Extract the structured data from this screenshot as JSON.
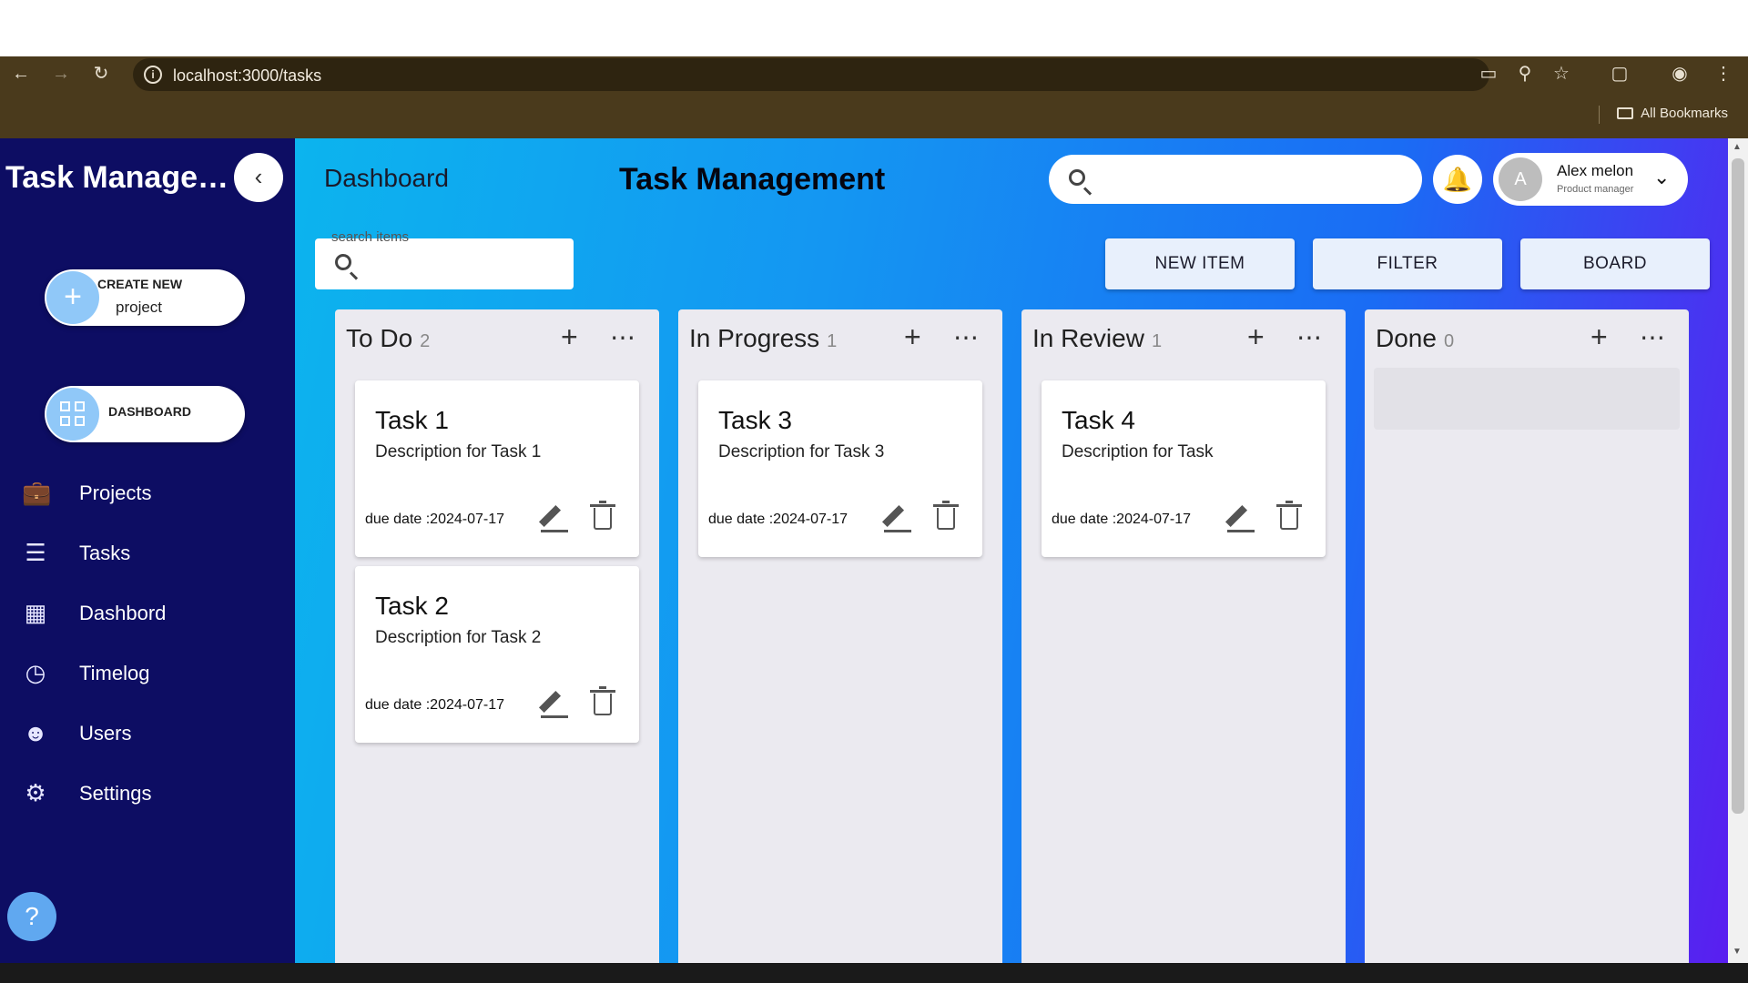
{
  "browser": {
    "url": "localhost:3000/tasks",
    "bookmarks_label": "All Bookmarks"
  },
  "sidebar": {
    "brand": "Task Manage…",
    "create": {
      "label": "CREATE NEW",
      "sub": "project"
    },
    "dashboard_pill": "DASHBOARD",
    "items": [
      {
        "label": "Projects",
        "icon": "briefcase-icon"
      },
      {
        "label": "Tasks",
        "icon": "list-icon"
      },
      {
        "label": "Dashbord",
        "icon": "grid-icon"
      },
      {
        "label": "Timelog",
        "icon": "timer-icon"
      },
      {
        "label": "Users",
        "icon": "users-icon"
      },
      {
        "label": "Settings",
        "icon": "gear-icon"
      }
    ]
  },
  "header": {
    "breadcrumb": "Dashboard",
    "title": "Task Management",
    "user": {
      "avatar_initial": "A",
      "name": "Alex melon",
      "role": "Product manager"
    }
  },
  "toolbar": {
    "search_label": "search items",
    "buttons": [
      "NEW ITEM",
      "FILTER",
      "BOARD"
    ]
  },
  "columns": [
    {
      "name": "To Do",
      "count": "2",
      "cards": [
        {
          "title": "Task 1",
          "description": "Description for Task 1",
          "due": "due date :2024-07-17"
        },
        {
          "title": "Task 2",
          "description": "Description for Task 2",
          "due": "due date :2024-07-17"
        }
      ]
    },
    {
      "name": "In Progress",
      "count": "1",
      "cards": [
        {
          "title": "Task 3",
          "description": "Description for Task 3",
          "due": "due date :2024-07-17"
        }
      ]
    },
    {
      "name": "In Review",
      "count": "1",
      "cards": [
        {
          "title": "Task 4",
          "description": "Description for Task",
          "due": "due date :2024-07-17"
        }
      ]
    },
    {
      "name": "Done",
      "count": "0",
      "cards": []
    }
  ],
  "colors": {
    "sidebar_bg": "#0d0d63",
    "gradient_start": "#0cb4ee",
    "gradient_end": "#5a1ef0",
    "column_bg": "#ebeaf0"
  }
}
